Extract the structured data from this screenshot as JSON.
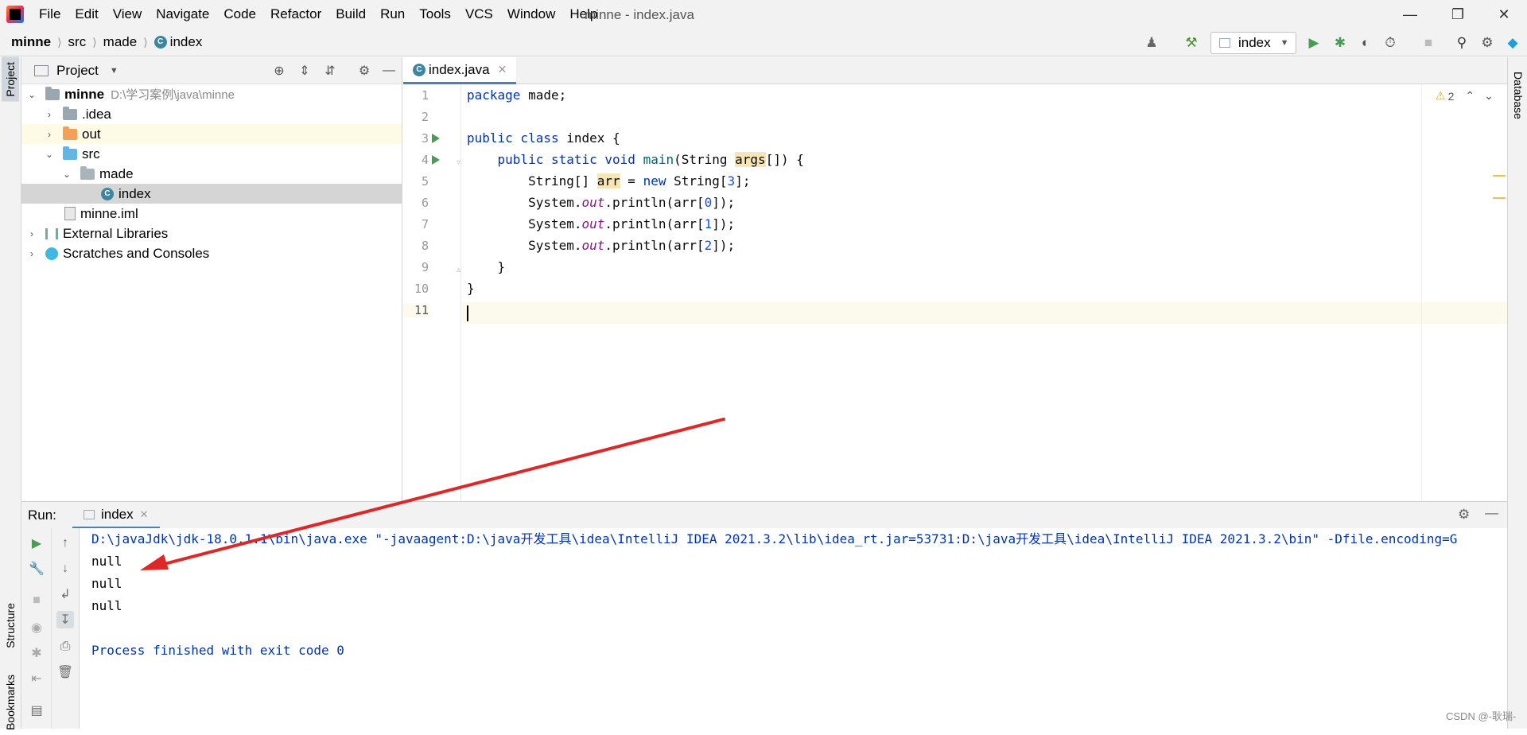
{
  "window": {
    "title": "minne - index.java"
  },
  "menu": [
    "File",
    "Edit",
    "View",
    "Navigate",
    "Code",
    "Refactor",
    "Build",
    "Run",
    "Tools",
    "VCS",
    "Window",
    "Help"
  ],
  "breadcrumb": [
    "minne",
    "src",
    "made",
    "index"
  ],
  "toolbar": {
    "run_config": "index"
  },
  "sidebar": {
    "project_tab": "Project",
    "structure_tab": "Structure",
    "bookmarks_tab": "Bookmarks",
    "database_tab": "Database"
  },
  "project": {
    "header": "Project",
    "tree": [
      {
        "label": "minne",
        "path": "D:\\学习案例\\java\\minne"
      },
      {
        "label": ".idea"
      },
      {
        "label": "out"
      },
      {
        "label": "src"
      },
      {
        "label": "made"
      },
      {
        "label": "index"
      },
      {
        "label": "minne.iml"
      },
      {
        "label": "External Libraries"
      },
      {
        "label": "Scratches and Consoles"
      }
    ]
  },
  "editor": {
    "tab": "index.java",
    "warnings": "2",
    "line_numbers": [
      "1",
      "2",
      "3",
      "4",
      "5",
      "6",
      "7",
      "8",
      "9",
      "10",
      "11"
    ]
  },
  "run": {
    "label": "Run:",
    "tab": "index",
    "output": [
      "D:\\javaJdk\\jdk-18.0.1.1\\bin\\java.exe \"-javaagent:D:\\java开发工具\\idea\\IntelliJ IDEA 2021.3.2\\lib\\idea_rt.jar=53731:D:\\java开发工具\\idea\\IntelliJ IDEA 2021.3.2\\bin\" -Dfile.encoding=G",
      "null",
      "null",
      "null",
      "",
      "Process finished with exit code 0"
    ]
  },
  "watermark": "CSDN @-耿瑞-",
  "colors": {
    "accent": "#4083c9",
    "annotation_arrow": "#e02727",
    "run_green": "#499c54"
  }
}
